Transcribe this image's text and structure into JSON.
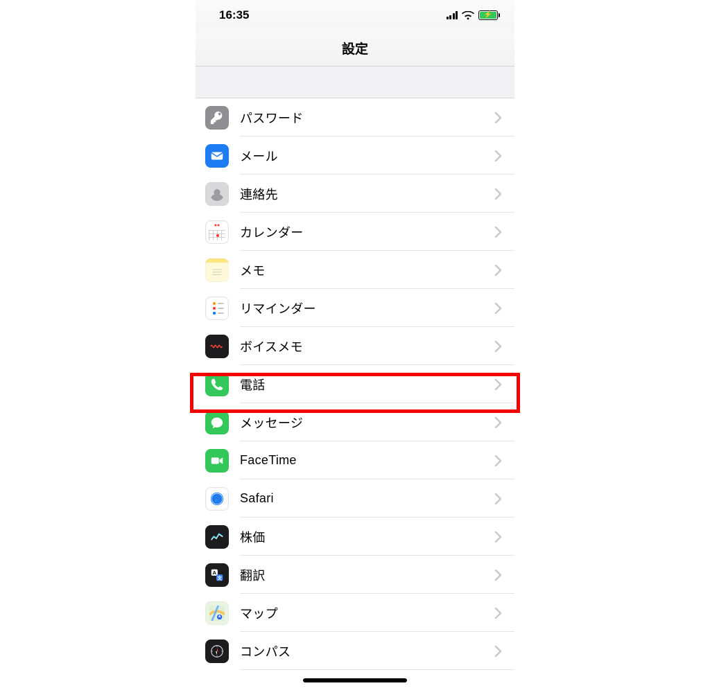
{
  "status": {
    "time": "16:35"
  },
  "nav": {
    "title": "設定"
  },
  "rows": [
    {
      "id": "passwords",
      "label": "パスワード"
    },
    {
      "id": "mail",
      "label": "メール"
    },
    {
      "id": "contacts",
      "label": "連絡先"
    },
    {
      "id": "calendar",
      "label": "カレンダー"
    },
    {
      "id": "notes",
      "label": "メモ"
    },
    {
      "id": "reminders",
      "label": "リマインダー"
    },
    {
      "id": "voicememo",
      "label": "ボイスメモ"
    },
    {
      "id": "phone",
      "label": "電話"
    },
    {
      "id": "messages",
      "label": "メッセージ"
    },
    {
      "id": "facetime",
      "label": "FaceTime"
    },
    {
      "id": "safari",
      "label": "Safari"
    },
    {
      "id": "stocks",
      "label": "株価"
    },
    {
      "id": "translate",
      "label": "翻訳"
    },
    {
      "id": "maps",
      "label": "マップ"
    },
    {
      "id": "compass",
      "label": "コンパス"
    }
  ],
  "highlight_row_id": "phone"
}
